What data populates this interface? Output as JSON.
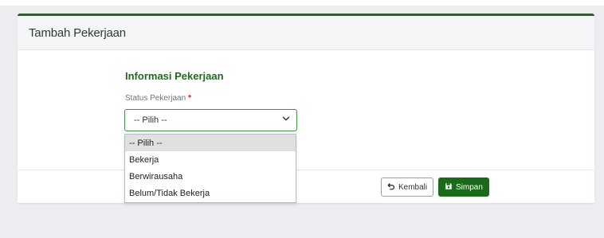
{
  "card": {
    "title": "Tambah Pekerjaan"
  },
  "section": {
    "title": "Informasi Pekerjaan"
  },
  "field": {
    "label": "Status Pekerjaan",
    "required_mark": "*",
    "selected_value": "-- Pilih --"
  },
  "dropdown": {
    "options": [
      "-- Pilih --",
      "Bekerja",
      "Berwirausaha",
      "Belum/Tidak Bekerja"
    ],
    "highlighted_index": 0
  },
  "footer": {
    "back_label": "Kembali",
    "save_label": "Simpan"
  },
  "colors": {
    "accent": "#1a6a1a",
    "required": "#d11b1b"
  },
  "icons": {
    "back": "undo-icon",
    "save": "floppy-disk-icon",
    "select": "chevron-down-icon"
  }
}
